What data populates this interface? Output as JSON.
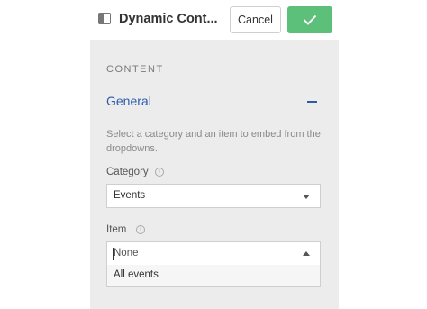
{
  "header": {
    "title": "Dynamic Cont...",
    "cancel_label": "Cancel",
    "save_icon": "check-icon"
  },
  "content": {
    "section_label": "CONTENT",
    "group_title": "General",
    "help_text": "Select a category and an item to embed from the dropdowns."
  },
  "category": {
    "label": "Category",
    "value": "Events"
  },
  "item": {
    "label": "Item",
    "placeholder": "None",
    "options": [
      "All events"
    ]
  },
  "colors": {
    "accent": "#2e5cad",
    "save_button": "#5cbf7a"
  }
}
